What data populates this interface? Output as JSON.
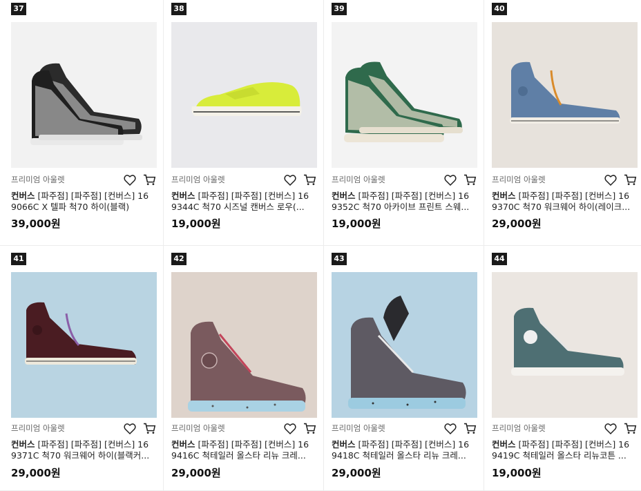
{
  "products": [
    {
      "rank": "37",
      "seller": "프리미엄 아울렛",
      "brand": "컨버스",
      "title_line1": " [파주점] [파주점] [컨버스] 16",
      "title_line2": "9066C X 텔파 척70 하이(블랙)",
      "price": "39,000원",
      "bg": "#f2f2f2"
    },
    {
      "rank": "38",
      "seller": "프리미엄 아울렛",
      "brand": "컨버스",
      "title_line1": " [파주점] [파주점] [컨버스] 16",
      "title_line2": "9344C 척70 시즈널 캔버스 로우(...",
      "price": "19,000원",
      "bg": "#e9e9ec"
    },
    {
      "rank": "39",
      "seller": "프리미엄 아울렛",
      "brand": "컨버스",
      "title_line1": " [파주점] [파주점] [컨버스] 16",
      "title_line2": "9352C 척70 아카이브 프린트 스웨...",
      "price": "19,000원",
      "bg": "#f3f3f3"
    },
    {
      "rank": "40",
      "seller": "프리미엄 아울렛",
      "brand": "컨버스",
      "title_line1": " [파주점] [파주점] [컨버스] 16",
      "title_line2": "9370C 척70 워크웨어 하이(레이크...",
      "price": "29,000원",
      "bg": "#e7e2dc"
    },
    {
      "rank": "41",
      "seller": "프리미엄 아울렛",
      "brand": "컨버스",
      "title_line1": " [파주점] [파주점] [컨버스] 16",
      "title_line2": "9371C 척70 워크웨어 하이(블랙커...",
      "price": "29,000원",
      "bg": "#b9d4e2"
    },
    {
      "rank": "42",
      "seller": "프리미엄 아울렛",
      "brand": "컨버스",
      "title_line1": " [파주점] [파주점] [컨버스] 16",
      "title_line2": "9416C 척테일러 올스타 리뉴 크레...",
      "price": "29,000원",
      "bg": "#ded3cb"
    },
    {
      "rank": "43",
      "seller": "프리미엄 아울렛",
      "brand": "컨버스",
      "title_line1": " [파주점] [파주점] [컨버스] 16",
      "title_line2": "9418C 척테일러 올스타 리뉴 크레...",
      "price": "29,000원",
      "bg": "#b7d3e3"
    },
    {
      "rank": "44",
      "seller": "프리미엄 아울렛",
      "brand": "컨버스",
      "title_line1": " [파주점] [파주점] [컨버스] 16",
      "title_line2": "9419C 척테일러 올스타 리뉴코튼 ...",
      "price": "19,000원",
      "bg": "#ebe6e1"
    }
  ]
}
